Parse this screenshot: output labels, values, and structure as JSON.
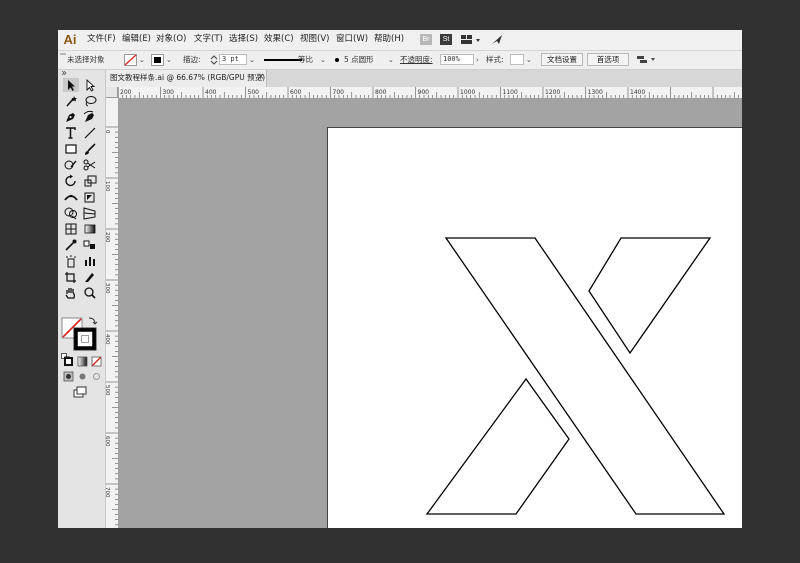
{
  "app": {
    "logo": "Ai",
    "menus": [
      "文件(F)",
      "编辑(E)",
      "对象(O)",
      "文字(T)",
      "选择(S)",
      "效果(C)",
      "视图(V)",
      "窗口(W)",
      "帮助(H)"
    ],
    "toolbar_icons": {
      "bridge": "Br",
      "stock": "St"
    }
  },
  "control_bar": {
    "selection_status": "未选择对象",
    "stroke_label": "描边:",
    "stroke_weight": "3 pt",
    "stroke_profile": "等比",
    "brush_definition": "5 点圆形",
    "opacity_label": "不透明度:",
    "opacity_value": "100%",
    "style_label": "样式:",
    "document_setup_button": "文档设置",
    "preferences_button": "首选项"
  },
  "document": {
    "tab_title": "图文教程样条.ai @ 66.67% (RGB/GPU 预览)",
    "close_glyph": "×"
  },
  "rulers": {
    "horizontal_labels": [
      "200",
      "300",
      "400",
      "500",
      "600",
      "700",
      "800",
      "900",
      "1000",
      "1100",
      "1200",
      "1300",
      "1400"
    ],
    "vertical_labels": [
      "0",
      "100",
      "200",
      "300",
      "400",
      "500",
      "600",
      "700",
      "800"
    ]
  },
  "colors": {
    "app_background": "#313131",
    "canvas_gray": "#a3a3a3",
    "artboard": "#ffffff",
    "outline_stroke": "#000000"
  },
  "tools": [
    "selection",
    "direct-selection",
    "magic-wand",
    "lasso",
    "pen",
    "curvature",
    "type",
    "line-segment",
    "rectangle",
    "paintbrush",
    "shaper",
    "scissors",
    "rotate",
    "scale",
    "width",
    "free-transform",
    "shape-builder",
    "perspective-grid",
    "mesh",
    "gradient",
    "eyedropper",
    "blend",
    "symbol-sprayer",
    "column-graph",
    "artboard",
    "slice",
    "hand",
    "zoom"
  ]
}
